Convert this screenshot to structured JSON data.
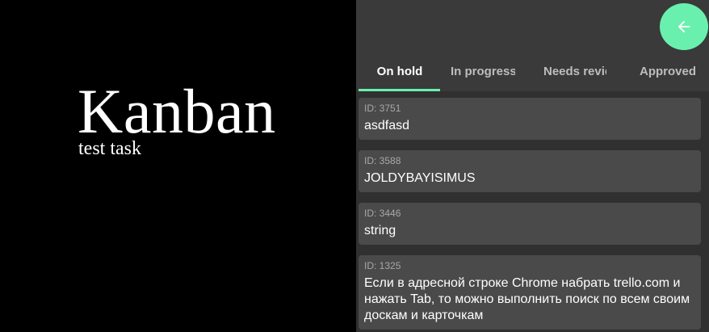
{
  "promo": {
    "title": "Kanban",
    "subtitle": "test task"
  },
  "appbar": {
    "fab_icon": "arrow-left-icon",
    "accent_color": "#69f0ae"
  },
  "tabs": [
    {
      "label": "On hold",
      "active": true
    },
    {
      "label": "In progress",
      "active": false
    },
    {
      "label": "Needs review",
      "active": false
    },
    {
      "label": "Approved",
      "active": false
    }
  ],
  "cards": [
    {
      "id_label": "ID: 3751",
      "title": "asdfasd"
    },
    {
      "id_label": "ID: 3588",
      "title": "JOLDYBAYISIMUS"
    },
    {
      "id_label": "ID: 3446",
      "title": "string"
    },
    {
      "id_label": "ID: 1325",
      "title": "Если в адресной строке Chrome набрать trello.com и нажать Tab, то можно выполнить поиск по всем своим доскам и карточкам"
    }
  ]
}
